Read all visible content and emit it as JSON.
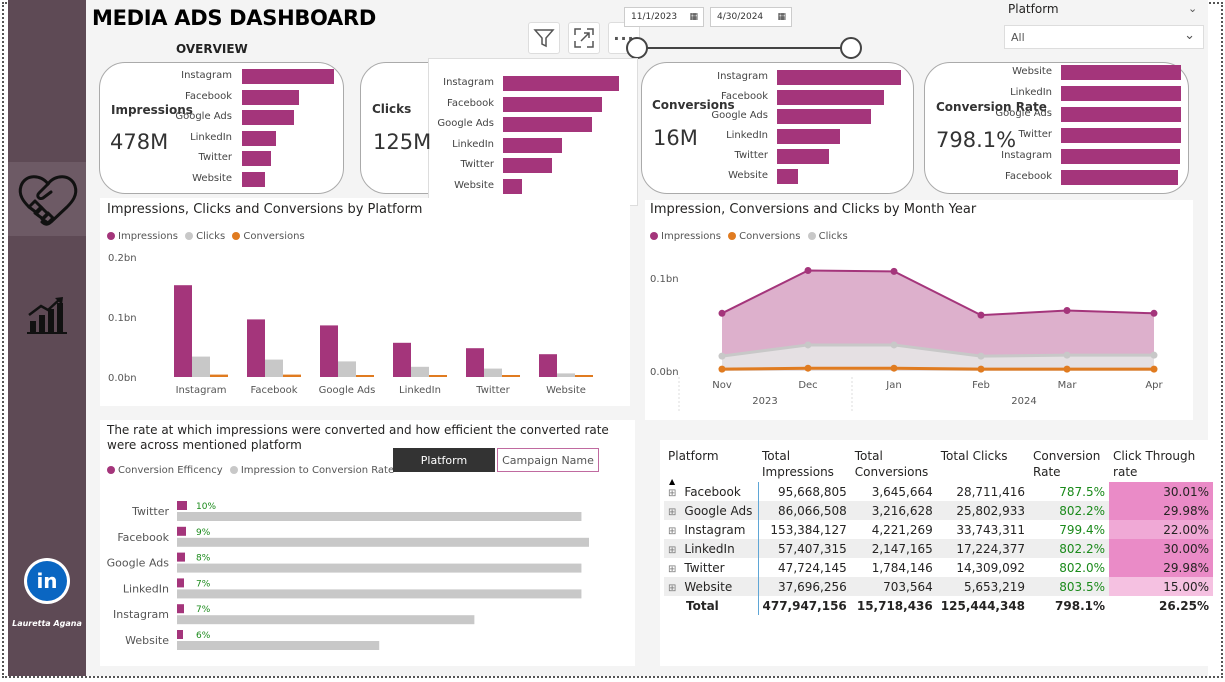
{
  "dashboard": {
    "title": "MEDIA ADS DASHBOARD",
    "overview_label": "OVERVIEW",
    "author": "Lauretta Agana",
    "linkedin_glyph": "in"
  },
  "filters": {
    "start_date": "11/1/2023",
    "end_date": "4/30/2024",
    "platform_label": "Platform",
    "platform_value": "All"
  },
  "toolbar": {
    "filter_icon": "filter-icon",
    "focus_icon": "focus-mode-icon",
    "more_label": "···"
  },
  "kpis": [
    {
      "label": "Impressions",
      "value": "478M",
      "categories": [
        "Instagram",
        "Facebook",
        "Google Ads",
        "LinkedIn",
        "Twitter",
        "Website"
      ],
      "values": [
        153384127,
        95668805,
        86066508,
        57407315,
        47724145,
        37696256
      ]
    },
    {
      "label": "Clicks",
      "value": "125M",
      "categories": [
        "Instagram",
        "Facebook",
        "Google Ads",
        "LinkedIn",
        "Twitter",
        "Website"
      ],
      "values": [
        33743311,
        28711416,
        25802933,
        17224377,
        14309092,
        5653219
      ]
    },
    {
      "label": "Conversions",
      "value": "16M",
      "categories": [
        "Instagram",
        "Facebook",
        "Google Ads",
        "LinkedIn",
        "Twitter",
        "Website"
      ],
      "values": [
        4221269,
        3645664,
        3216628,
        2147165,
        1784146,
        703564
      ]
    },
    {
      "label": "Conversion Rate",
      "value": "798.1%",
      "categories": [
        "Website",
        "LinkedIn",
        "Google Ads",
        "Twitter",
        "Instagram",
        "Facebook"
      ],
      "values": [
        803.5,
        802.2,
        802.2,
        802.0,
        799.4,
        787.5
      ]
    }
  ],
  "chart_data": [
    {
      "type": "bar",
      "title": "Impressions, Clicks and Conversions by Platform",
      "categories": [
        "Instagram",
        "Facebook",
        "Google Ads",
        "LinkedIn",
        "Twitter",
        "Website"
      ],
      "series": [
        {
          "name": "Impressions",
          "values": [
            0.153,
            0.096,
            0.086,
            0.057,
            0.048,
            0.038
          ]
        },
        {
          "name": "Clicks",
          "values": [
            0.034,
            0.029,
            0.026,
            0.017,
            0.014,
            0.006
          ]
        },
        {
          "name": "Conversions",
          "values": [
            0.004,
            0.004,
            0.003,
            0.002,
            0.002,
            0.001
          ]
        }
      ],
      "y_ticks": [
        "0.0bn",
        "0.1bn",
        "0.2bn"
      ],
      "ylim": [
        0,
        0.2
      ],
      "legend": "top-left",
      "colors": [
        "#a4357b",
        "#c8c8c8",
        "#e07b20"
      ]
    },
    {
      "type": "area",
      "title": "Impression, Conversions and Clicks by Month Year",
      "x": [
        "Nov",
        "Dec",
        "Jan",
        "Feb",
        "Mar",
        "Apr"
      ],
      "x_years": [
        "2023",
        "2024"
      ],
      "series": [
        {
          "name": "Impressions",
          "values": [
            0.062,
            0.108,
            0.107,
            0.06,
            0.065,
            0.062
          ]
        },
        {
          "name": "Conversions",
          "values": [
            0.002,
            0.003,
            0.003,
            0.002,
            0.002,
            0.002
          ]
        },
        {
          "name": "Clicks",
          "values": [
            0.016,
            0.028,
            0.028,
            0.016,
            0.017,
            0.017
          ]
        }
      ],
      "y_ticks": [
        "0.0bn",
        "0.1bn"
      ],
      "ylim": [
        0,
        0.13
      ],
      "legend": "top-left",
      "colors": [
        "#a4357b",
        "#e07b20",
        "#c8c8c8"
      ]
    },
    {
      "type": "bar",
      "title": "The rate at which impressions were converted and how efficient the converted rate were across mentioned platform",
      "categories": [
        "Twitter",
        "Facebook",
        "Google Ads",
        "LinkedIn",
        "Instagram",
        "Website"
      ],
      "series": [
        {
          "name": "Conversion Efficency",
          "values": [
            10,
            9,
            8,
            7,
            7,
            6
          ],
          "labels": [
            "10%",
            "9%",
            "8%",
            "7%",
            "7%",
            "6%"
          ]
        },
        {
          "name": "Impression to Conversion Rate",
          "values": [
            3.74,
            3.81,
            3.74,
            3.74,
            2.75,
            1.87
          ]
        }
      ],
      "legend": "top-left",
      "colors": [
        "#a4357b",
        "#c8c8c8"
      ]
    }
  ],
  "segment_buttons": {
    "platform": "Platform",
    "campaign": "Campaign Name"
  },
  "table": {
    "headers": [
      "Platform",
      "Total Impressions",
      "Total Conversions",
      "Total Clicks",
      "Conversion Rate",
      "Click Through rate"
    ],
    "rows": [
      {
        "platform": "Facebook",
        "impressions": "95,668,805",
        "conversions": "3,645,664",
        "clicks": "28,711,416",
        "conv_rate": "787.5%",
        "ctr": "30.01%",
        "ctr_color": "#ea8bc7"
      },
      {
        "platform": "Google Ads",
        "impressions": "86,066,508",
        "conversions": "3,216,628",
        "clicks": "25,802,933",
        "conv_rate": "802.2%",
        "ctr": "29.98%",
        "ctr_color": "#ea8bc7"
      },
      {
        "platform": "Instagram",
        "impressions": "153,384,127",
        "conversions": "4,221,269",
        "clicks": "33,743,311",
        "conv_rate": "799.4%",
        "ctr": "22.00%",
        "ctr_color": "#f0a9d6"
      },
      {
        "platform": "LinkedIn",
        "impressions": "57,407,315",
        "conversions": "2,147,165",
        "clicks": "17,224,377",
        "conv_rate": "802.2%",
        "ctr": "30.00%",
        "ctr_color": "#ea8bc7"
      },
      {
        "platform": "Twitter",
        "impressions": "47,724,145",
        "conversions": "1,784,146",
        "clicks": "14,309,092",
        "conv_rate": "802.0%",
        "ctr": "29.98%",
        "ctr_color": "#ea8bc7"
      },
      {
        "platform": "Website",
        "impressions": "37,696,256",
        "conversions": "703,564",
        "clicks": "5,653,219",
        "conv_rate": "803.5%",
        "ctr": "15.00%",
        "ctr_color": "#f5c1e1"
      }
    ],
    "total": {
      "label": "Total",
      "impressions": "477,947,156",
      "conversions": "15,718,436",
      "clicks": "125,444,348",
      "conv_rate": "798.1%",
      "ctr": "26.25%"
    }
  }
}
